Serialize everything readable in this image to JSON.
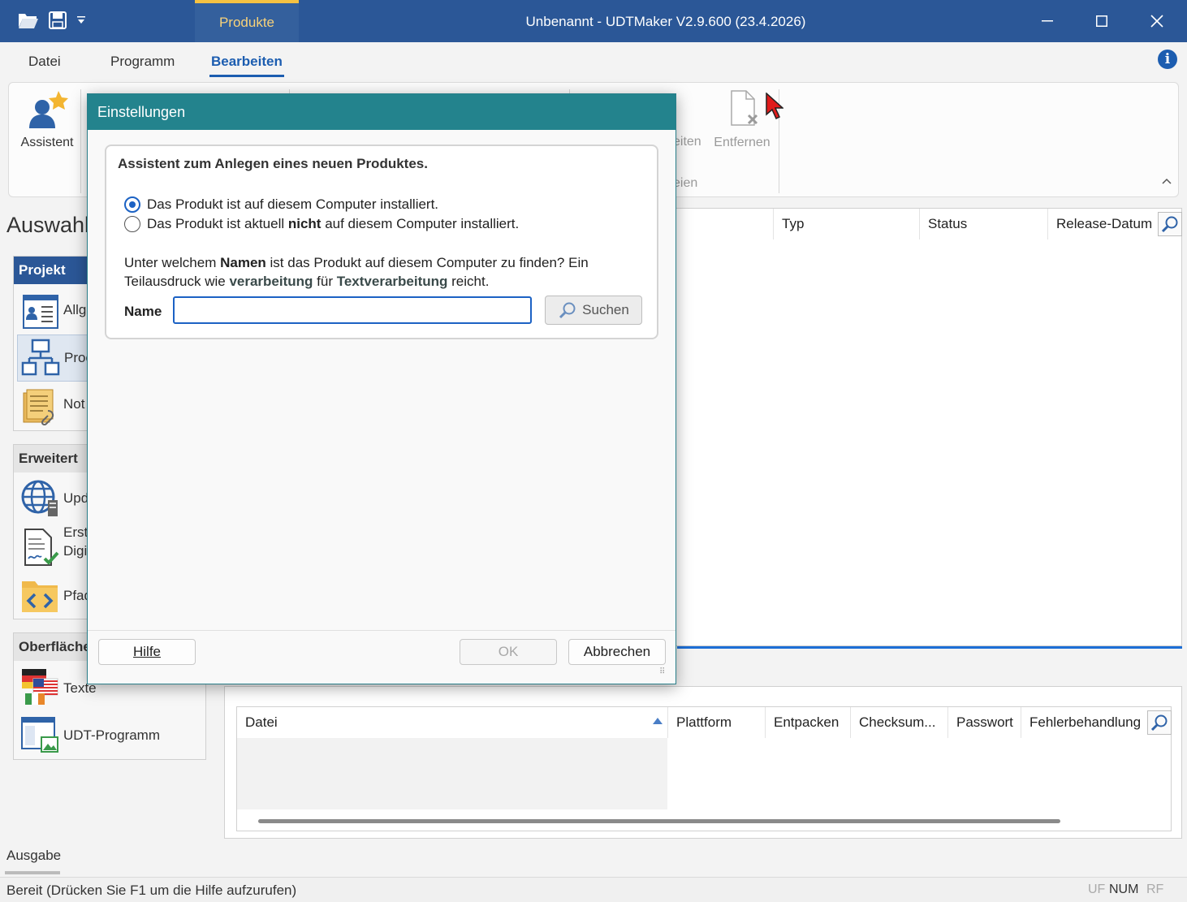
{
  "window": {
    "title": "Unbenannt - UDTMaker V2.9.600 (23.4.2026)",
    "context_tab": "Produkte"
  },
  "ribbon_tabs": [
    "Datei",
    "Programm",
    "Bearbeiten"
  ],
  "ribbon": {
    "assistant_label": "Assistent",
    "bearbeiten_partial": "eiten",
    "entfernen_label": "Entfernen",
    "group_partial": "eien"
  },
  "left_panel": {
    "title": "Auswahl",
    "groups": [
      {
        "head": "Projekt",
        "items": [
          "Allg",
          "Proc",
          "Not"
        ]
      },
      {
        "head": "Erweitert",
        "items": [
          "Upd",
          "Erst",
          "Digi",
          "Pfad"
        ]
      },
      {
        "head": "Oberfläche",
        "items": [
          "Texte",
          "UDT-Programm"
        ]
      }
    ]
  },
  "main_grid": {
    "columns": [
      "Typ",
      "Status",
      "Release-Datum"
    ]
  },
  "bottom_grid": {
    "columns": [
      "Datei",
      "Plattform",
      "Entpacken",
      "Checksum...",
      "Passwort",
      "Fehlerbehandlung"
    ]
  },
  "output": {
    "label": "Ausgabe"
  },
  "status": {
    "text": "Bereit (Drücken Sie F1 um die Hilfe aufzurufen)",
    "uf": "UF",
    "num": "NUM",
    "rf": "RF"
  },
  "dialog": {
    "title": "Einstellungen",
    "heading": "Assistent zum Anlegen eines neuen Produktes.",
    "radio1": "Das Produkt ist auf diesem Computer installiert.",
    "radio2_a": "Das Produkt ist aktuell ",
    "radio2_b": "nicht",
    "radio2_c": " auf diesem Computer installiert.",
    "instr_a": "Unter welchem ",
    "instr_b": "Namen",
    "instr_c": " ist das Produkt auf diesem Computer zu finden? Ein Teilausdruck wie ",
    "instr_d": "verarbeitung",
    "instr_e": " für ",
    "instr_f": "Textverarbeitung",
    "instr_g": " reicht.",
    "name_label": "Name",
    "name_value": "",
    "search_label": "Suchen",
    "help_label": "Hilfe",
    "ok_label": "OK",
    "cancel_label": "Abbrechen"
  },
  "colors": {
    "titlebar": "#2b5797",
    "dialog_title": "#23838d",
    "accent": "#1c5db0"
  }
}
